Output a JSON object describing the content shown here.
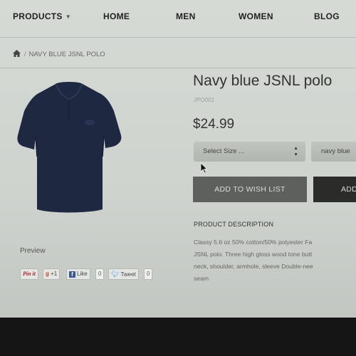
{
  "nav": {
    "items": [
      "PRODUCTS",
      "HOME",
      "MEN",
      "WOMEN",
      "BLOG"
    ]
  },
  "breadcrumb": {
    "separator": "/",
    "current": "NAVY BLUE JSNL POLO"
  },
  "product": {
    "title": "Navy blue JSNL polo",
    "sku": "JPO001",
    "price": "$24.99",
    "image_color": "#1f2841",
    "size_select": {
      "value": "Select Size ..."
    },
    "color_select": {
      "value": "navy blue"
    },
    "wish_label": "ADD TO WISH LIST",
    "add_label": "ADD",
    "preview_label": "Preview",
    "description_heading": "PRODUCT DESCRIPTION",
    "description_lines": [
      "Classy 5.6 oz 50% cotton/50% polyester Fa",
      "JSNL polo. Three high gloss wood tone butt",
      "neck, shoulder, armhole, sleeve Double-nee",
      "seam"
    ]
  },
  "social": {
    "pinit_label": "Pin it",
    "gplus_label": "+1",
    "fb_label": "Like",
    "fb_count": "0",
    "tweet_label": "Tweet",
    "tweet_count": "0"
  }
}
